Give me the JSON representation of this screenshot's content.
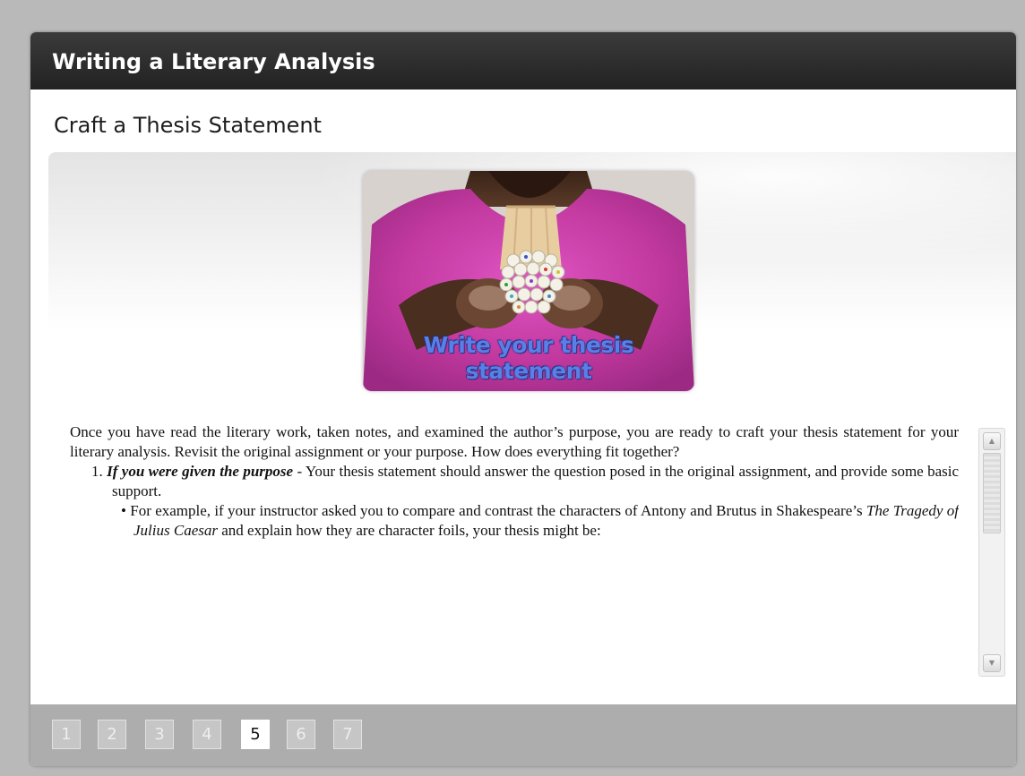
{
  "course_title": "Writing a Literary Analysis",
  "section_title": "Craft a Thesis Statement",
  "image": {
    "caption": "Write your thesis statement",
    "icon": "woman-holding-pencils-photo"
  },
  "content": {
    "intro": "Once you have read the literary work, taken notes, and examined the author’s purpose, you are ready to craft your thesis statement for your literary analysis. Revisit the original assignment or your purpose. How does everything fit together?",
    "item1": {
      "number": "1.",
      "heading": "If you were given the purpose",
      "text": " - Your thesis statement should answer the question posed in the original assignment, and provide some basic support."
    },
    "bullet1": {
      "marker": "•",
      "text_before": "For example, if your instructor asked you to compare and contrast the characters of Antony and Brutus in Shakespeare’s ",
      "title": "The Tragedy of Julius Caesar",
      "text_after": " and explain how they are character foils, your thesis might be:"
    }
  },
  "scrollbar": {
    "up_icon": "scroll-up-arrow-icon",
    "down_icon": "scroll-down-arrow-icon"
  },
  "pager": {
    "pages": [
      "1",
      "2",
      "3",
      "4",
      "5",
      "6",
      "7"
    ],
    "current": "5"
  },
  "colors": {
    "titlebar": "#2b2b2b",
    "pager_bg": "#adadad",
    "caption": "#5a7fe6"
  }
}
